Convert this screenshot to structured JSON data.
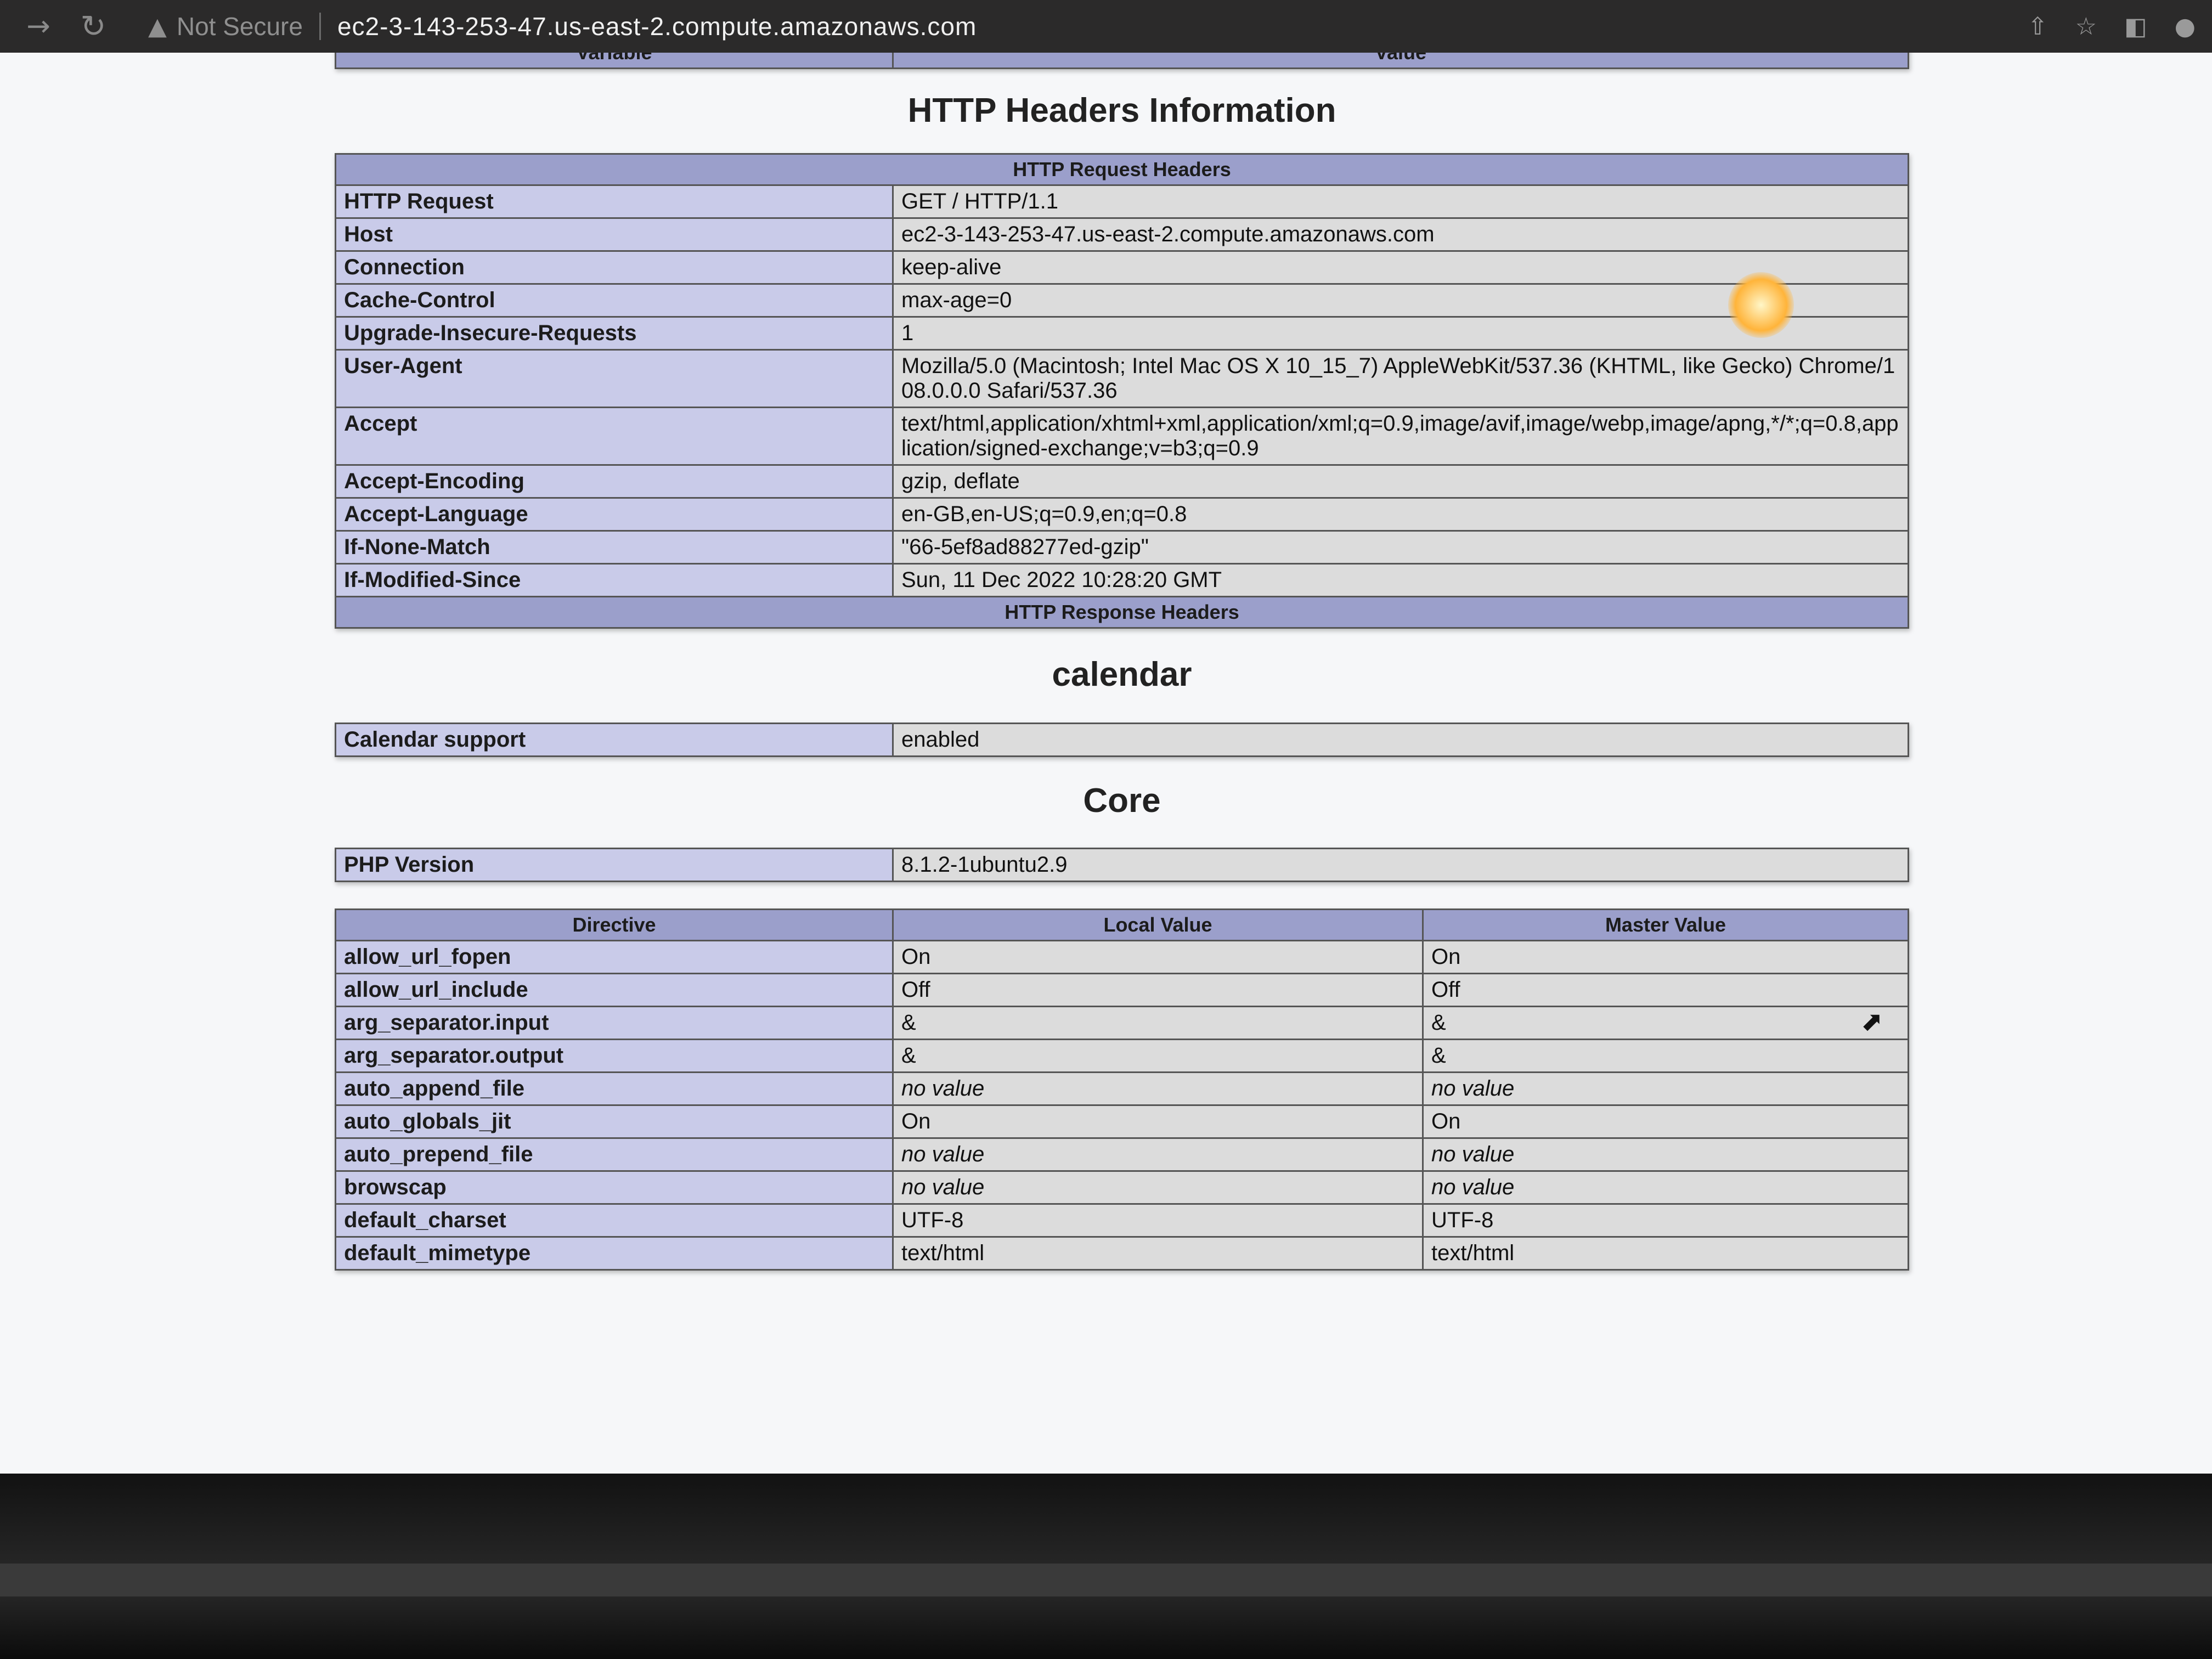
{
  "browser": {
    "back_icon": "→",
    "reload_icon": "C",
    "warning_icon": "▲",
    "not_secure_label": "Not Secure",
    "url": "ec2-3-143-253-47.us-east-2.compute.amazonaws.com"
  },
  "top_table": {
    "variable_header": "Variable",
    "value_header": "Value"
  },
  "http_headers": {
    "title": "HTTP Headers Information",
    "request_header": "HTTP Request Headers",
    "rows": [
      {
        "name": "HTTP Request",
        "value": "GET / HTTP/1.1"
      },
      {
        "name": "Host",
        "value": "ec2-3-143-253-47.us-east-2.compute.amazonaws.com"
      },
      {
        "name": "Connection",
        "value": "keep-alive"
      },
      {
        "name": "Cache-Control",
        "value": "max-age=0"
      },
      {
        "name": "Upgrade-Insecure-Requests",
        "value": "1"
      },
      {
        "name": "User-Agent",
        "value": "Mozilla/5.0 (Macintosh; Intel Mac OS X 10_15_7) AppleWebKit/537.36 (KHTML, like Gecko) Chrome/108.0.0.0 Safari/537.36"
      },
      {
        "name": "Accept",
        "value": "text/html,application/xhtml+xml,application/xml;q=0.9,image/avif,image/webp,image/apng,*/*;q=0.8,application/signed-exchange;v=b3;q=0.9"
      },
      {
        "name": "Accept-Encoding",
        "value": "gzip, deflate"
      },
      {
        "name": "Accept-Language",
        "value": "en-GB,en-US;q=0.9,en;q=0.8"
      },
      {
        "name": "If-None-Match",
        "value": "\"66-5ef8ad88277ed-gzip\""
      },
      {
        "name": "If-Modified-Since",
        "value": "Sun, 11 Dec 2022 10:28:20 GMT"
      }
    ],
    "response_header": "HTTP Response Headers"
  },
  "calendar": {
    "title": "calendar",
    "label": "Calendar support",
    "value": "enabled"
  },
  "core": {
    "title": "Core",
    "php_version_label": "PHP Version",
    "php_version": "8.1.2-1ubuntu2.9",
    "columns": [
      "Directive",
      "Local Value",
      "Master Value"
    ],
    "directives": [
      {
        "name": "allow_url_fopen",
        "local": "On",
        "master": "On"
      },
      {
        "name": "allow_url_include",
        "local": "Off",
        "master": "Off"
      },
      {
        "name": "arg_separator.input",
        "local": "&",
        "master": "&"
      },
      {
        "name": "arg_separator.output",
        "local": "&",
        "master": "&"
      },
      {
        "name": "auto_append_file",
        "local": "no value",
        "master": "no value"
      },
      {
        "name": "auto_globals_jit",
        "local": "On",
        "master": "On"
      },
      {
        "name": "auto_prepend_file",
        "local": "no value",
        "master": "no value"
      },
      {
        "name": "browscap",
        "local": "no value",
        "master": "no value"
      },
      {
        "name": "default_charset",
        "local": "UTF-8",
        "master": "UTF-8"
      },
      {
        "name": "default_mimetype",
        "local": "text/html",
        "master": "text/html"
      }
    ]
  }
}
